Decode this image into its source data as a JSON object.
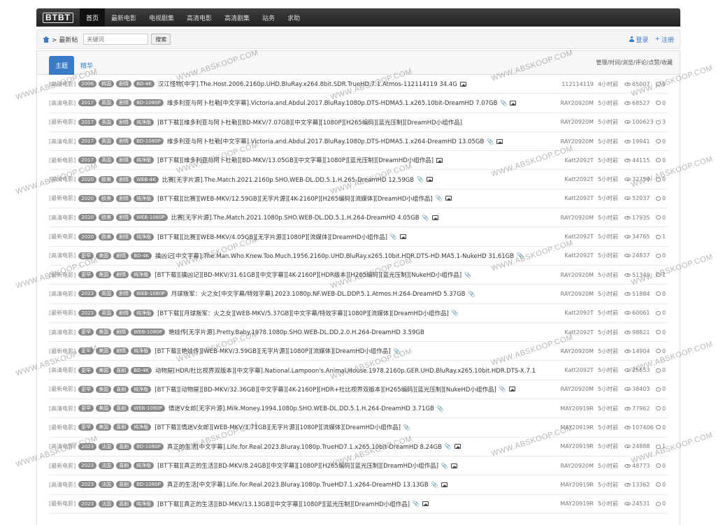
{
  "logo": "BTBT",
  "nav": [
    "首页",
    "最新电影",
    "电视剧集",
    "高清电影",
    "高清剧集",
    "站务",
    "求助"
  ],
  "breadcrumb": {
    "label": "> 最新帖",
    "search_placeholder": "关键词",
    "search_button": "搜索",
    "login": "登录",
    "register": "注册"
  },
  "tabs": {
    "main": "主题",
    "featured": "精华"
  },
  "columns_label": "管理/时间/浏览/评论/点赞/收藏",
  "watermark": "WWW.ABSKOOP.COM",
  "rows": [
    {
      "cat": "[高清电影]",
      "tags": [
        "2006",
        "韩国",
        "剧情",
        "BD-4K"
      ],
      "title": "汉江怪物[中字].The.Host.2006.2160p.UHD.BluRay.x264.8bit.SDR.TrueHD.7.1.Atmos-112114119 34.4G",
      "clip": false,
      "img": true,
      "author": "112114119",
      "time": "4小时前",
      "views": "65007",
      "comments": "0"
    },
    {
      "cat": "[高清电影]",
      "tags": [
        "2017",
        "英国",
        "剧情",
        "BD-1080P"
      ],
      "title": "维多利亚与阿卜杜勒[中文字幕].Victoria.and.Abdul.2017.BluRay.1080p.DTS-HDMA5.1.x265.10bit-DreamHD 7.07GB",
      "clip": true,
      "img": true,
      "author": "RAY20920M",
      "time": "5小时前",
      "views": "68527",
      "comments": "0"
    },
    {
      "cat": "[最新电影]",
      "tags": [
        "2017",
        "英国",
        "剧情",
        "纯净版"
      ],
      "title": "[BT下载][维多利亚与阿卜杜勒][BD-MKV/7.07GB][中文字幕][1080P][H265编码][蓝光压制][DreamHD小组作品]",
      "clip": false,
      "img": false,
      "author": "RAY20920M",
      "time": "5小时前",
      "views": "100623",
      "comments": "3"
    },
    {
      "cat": "[高清电影]",
      "tags": [
        "2017",
        "英国",
        "剧情",
        "BD-1080P"
      ],
      "title": "维多利亚与阿卜杜勒[中文字幕].Victoria.and.Abdul.2017.BluRay.1080p.DTS-HDMA5.1.x264-DreamHD 13.05GB",
      "clip": true,
      "img": true,
      "author": "RAY20920M",
      "time": "5小时前",
      "views": "19941",
      "comments": "0"
    },
    {
      "cat": "[最新电影]",
      "tags": [
        "2017",
        "英国",
        "剧情",
        "纯净版"
      ],
      "title": "[BT下载][维多利亚与阿卜杜勒][BD-MKV/13.05GB][中文字幕][1080P][蓝光压制][DreamHD小组作品]",
      "clip": false,
      "img": true,
      "author": "Katt2092T",
      "time": "5小时前",
      "views": "44115",
      "comments": "0"
    },
    {
      "cat": "[高清电影]",
      "tags": [
        "2020",
        "欧美",
        "剧情",
        "WEB-4K"
      ],
      "title": "比赛[无字片源].The.Match.2021.2160p.SHO.WEB-DL.DD.5.1.H.265-DreamHD 12.59GB",
      "clip": true,
      "img": true,
      "author": "Katt2092T",
      "time": "5小时前",
      "views": "32759",
      "comments": "0"
    },
    {
      "cat": "[最新电影]",
      "tags": [
        "2020",
        "欧美",
        "剧情",
        "纯净版"
      ],
      "title": "[BT下载][比赛][WEB-MKV/12.59GB][无字片源][4K-2160P][H265编码][流媒体][DreamHD小组作品]",
      "clip": true,
      "img": true,
      "author": "Katt2092T",
      "time": "5小时前",
      "views": "52037",
      "comments": "0"
    },
    {
      "cat": "[高清电影]",
      "tags": [
        "2020",
        "欧美",
        "剧情",
        "WEB-1080P"
      ],
      "title": "比赛[无字片源].The.Match.2021.1080p.SHO.WEB-DL.DD.5.1.H.264-DreamHD 4.05GB",
      "clip": true,
      "img": true,
      "author": "RAY20920M",
      "time": "5小时前",
      "views": "17935",
      "comments": "0"
    },
    {
      "cat": "[最新电影]",
      "tags": [
        "2020",
        "欧美",
        "剧情",
        "纯净版"
      ],
      "title": "[BT下载][比赛][WEB-MKV/4.05GB][无字片源][1080P][流媒体][DreamHD小组作品]",
      "clip": true,
      "img": true,
      "author": "Katt2092T",
      "time": "5小时前",
      "views": "34765",
      "comments": "1"
    },
    {
      "cat": "[高清电影]",
      "tags": [
        "更早",
        "美国",
        "剧情",
        "BD-4K"
      ],
      "title": "擒凶记[中文字幕].The.Man.Who.Knew.Too.Much.1956.2160p.UHD.BluRay.x265.10bit.HDR.DTS-HD.MA5.1-NukeHD 31.61GB",
      "clip": true,
      "img": false,
      "author": "Katt2092T",
      "time": "5小时前",
      "views": "24837",
      "comments": "0"
    },
    {
      "cat": "[最新电影]",
      "tags": [
        "更早",
        "美国",
        "剧情",
        "纯净版"
      ],
      "title": "[BT下载][擒凶记][BD-MKV/31.61GB][中文字幕][4K-2160P][HDR版本][H265编码][蓝光压制][NukeHD小组作品]",
      "clip": true,
      "img": false,
      "author": "RAY20920M",
      "time": "5小时前",
      "views": "51340",
      "comments": "1"
    },
    {
      "cat": "[高清电影]",
      "tags": [
        "2023",
        "英国",
        "剧情",
        "WEB-1080P"
      ],
      "title": "月球叛军：火之女[中文字幕/特效字幕].2023.1080p.NF.WEB-DL.DDP.5.1.Atmos.H.264-DreamHD 5.37GB",
      "clip": true,
      "img": false,
      "author": "RAY20920M",
      "time": "5小时前",
      "views": "51884",
      "comments": "0"
    },
    {
      "cat": "[最新电影]",
      "tags": [
        "2023",
        "英国",
        "剧情",
        "纯净版"
      ],
      "title": "[BT下载][月球叛军：火之女][WEB-MKV/5.37GB][中文字幕/特效字幕][1080P][流媒体][DreamHD小组作品]",
      "clip": true,
      "img": false,
      "author": "Katt2092T",
      "time": "5小时前",
      "views": "60061",
      "comments": "0"
    },
    {
      "cat": "[高清电影]",
      "tags": [
        "更早",
        "美国",
        "剧情",
        "WEB-1080P"
      ],
      "title": "艳娃传[无字片源].Pretty.Baby.1978.1080p.SHO.WEB-DL.DD.2.0.H.264-DreamHD 3.59GB",
      "clip": false,
      "img": false,
      "author": "Katt2092T",
      "time": "5小时前",
      "views": "98821",
      "comments": "0"
    },
    {
      "cat": "[最新电影]",
      "tags": [
        "更早",
        "美国",
        "剧情",
        "纯净版"
      ],
      "title": "[BT下载][艳娃传][WEB-MKV/3.59GB][无字片源][1080P][流媒体][DreamHD小组作品]",
      "clip": true,
      "img": false,
      "author": "RAY20920M",
      "time": "5小时前",
      "views": "14904",
      "comments": "0"
    },
    {
      "cat": "[高清电影]",
      "tags": [
        "更早",
        "美国",
        "喜剧",
        "BD-4K"
      ],
      "title": "动物屋[HDR/杜比视界双版本][中文字幕].National.Lampoon's.Animal.House.1978.2160p.GER.UHD.BluRay.x265.10bit.HDR.DTS-X.7.1",
      "clip": false,
      "img": false,
      "author": "Katt2092T",
      "time": "5小时前",
      "views": "25653",
      "comments": "0"
    },
    {
      "cat": "[最新电影]",
      "tags": [
        "更早",
        "美国",
        "喜剧",
        "纯净版"
      ],
      "title": "[BT下载][动物屋][BD-MKV/32.36GB][中文字幕][4K-2160P][HDR+杜比视界双版本][H265编码][蓝光压制][NukeHD小组作品]",
      "clip": true,
      "img": true,
      "author": "RAY20920M",
      "time": "5小时前",
      "views": "38403",
      "comments": "0"
    },
    {
      "cat": "[高清电影]",
      "tags": [
        "更早",
        "美国",
        "喜剧",
        "WEB-1080P"
      ],
      "title": "情迷V女郎[无字片源].Milk.Money.1994.1080p.SHO.WEB-DL.DD.5.1.H.264-DreamHD 3.71GB",
      "clip": true,
      "img": false,
      "author": "MAY20919R",
      "time": "5小时前",
      "views": "77962",
      "comments": "0"
    },
    {
      "cat": "[最新电影]",
      "tags": [
        "更早",
        "美国",
        "喜剧",
        "纯净版"
      ],
      "title": "[BT下载][情迷V女郎][WEB-MKV/3.71GB][无字片源][1080P][流媒体][DreamHD小组作品]",
      "clip": true,
      "img": false,
      "author": "MAY20919R",
      "time": "5小时前",
      "views": "107406",
      "comments": "0"
    },
    {
      "cat": "[高清电影]",
      "tags": [
        "2023",
        "法国",
        "喜剧",
        "BD-1080P"
      ],
      "title": "真正的生活[中文字幕].Life.for.Real.2023.Bluray.1080p.TrueHD7.1.x265.10bit-DreamHD 8.24GB",
      "clip": true,
      "img": true,
      "author": "MAY20919R",
      "time": "5小时前",
      "views": "24888",
      "comments": "1"
    },
    {
      "cat": "[最新电影]",
      "tags": [
        "2023",
        "法国",
        "喜剧",
        "纯净版"
      ],
      "title": "[BT下载][真正的生活][BD-MKV/8.24GB][中文字幕][1080P][H265编码][蓝光压制][DreamHD小组作品]",
      "clip": true,
      "img": true,
      "author": "RAY20920M",
      "time": "5小时前",
      "views": "48773",
      "comments": "0"
    },
    {
      "cat": "[高清电影]",
      "tags": [
        "2023",
        "法国",
        "喜剧",
        "BD-1080P"
      ],
      "title": "真正的生活[中文字幕].Life.for.Real.2023.Bluray.1080p.TrueHD7.1.x264-DreamHD 13.13GB",
      "clip": true,
      "img": true,
      "author": "MAY20919R",
      "time": "5小时前",
      "views": "13362",
      "comments": "0"
    },
    {
      "cat": "[最新电影]",
      "tags": [
        "2023",
        "法国",
        "喜剧",
        "纯净版"
      ],
      "title": "[BT下载][真正的生活][BD-MKV/13.13GB][中文字幕][1080P][蓝光压制][DreamHD小组作品]",
      "clip": true,
      "img": true,
      "author": "MAY20919R",
      "time": "5小时前",
      "views": "24531",
      "comments": "0"
    }
  ]
}
